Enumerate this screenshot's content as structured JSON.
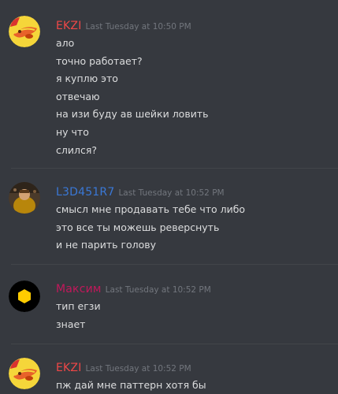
{
  "messages": [
    {
      "username": "EKZI",
      "username_color": "#f04747",
      "timestamp": "Last Tuesday at 10:50 PM",
      "avatar": "hotdog-avatar",
      "lines": [
        "ало",
        "точно работает?",
        "я куплю это",
        "отвечаю",
        "на изи буду ав шейки ловить",
        "ну что",
        "слился?"
      ]
    },
    {
      "username": "L3D451R7",
      "username_color": "#3a78d6",
      "timestamp": "Last Tuesday at 10:52 PM",
      "avatar": "photo-avatar",
      "lines": [
        "смысл мне продавать тебе что либо",
        "это все ты можешь реверснуть",
        "и не парить голову"
      ]
    },
    {
      "username": "Максим",
      "username_color": "#c2185b",
      "timestamp": "Last Tuesday at 10:52 PM",
      "avatar": "hexagon-avatar",
      "lines": [
        "тип егзи",
        "знает"
      ]
    },
    {
      "username": "EKZI",
      "username_color": "#f04747",
      "timestamp": "Last Tuesday at 10:52 PM",
      "avatar": "hotdog-avatar",
      "lines": [
        "пж дай мне паттерн хотя бы"
      ]
    }
  ]
}
